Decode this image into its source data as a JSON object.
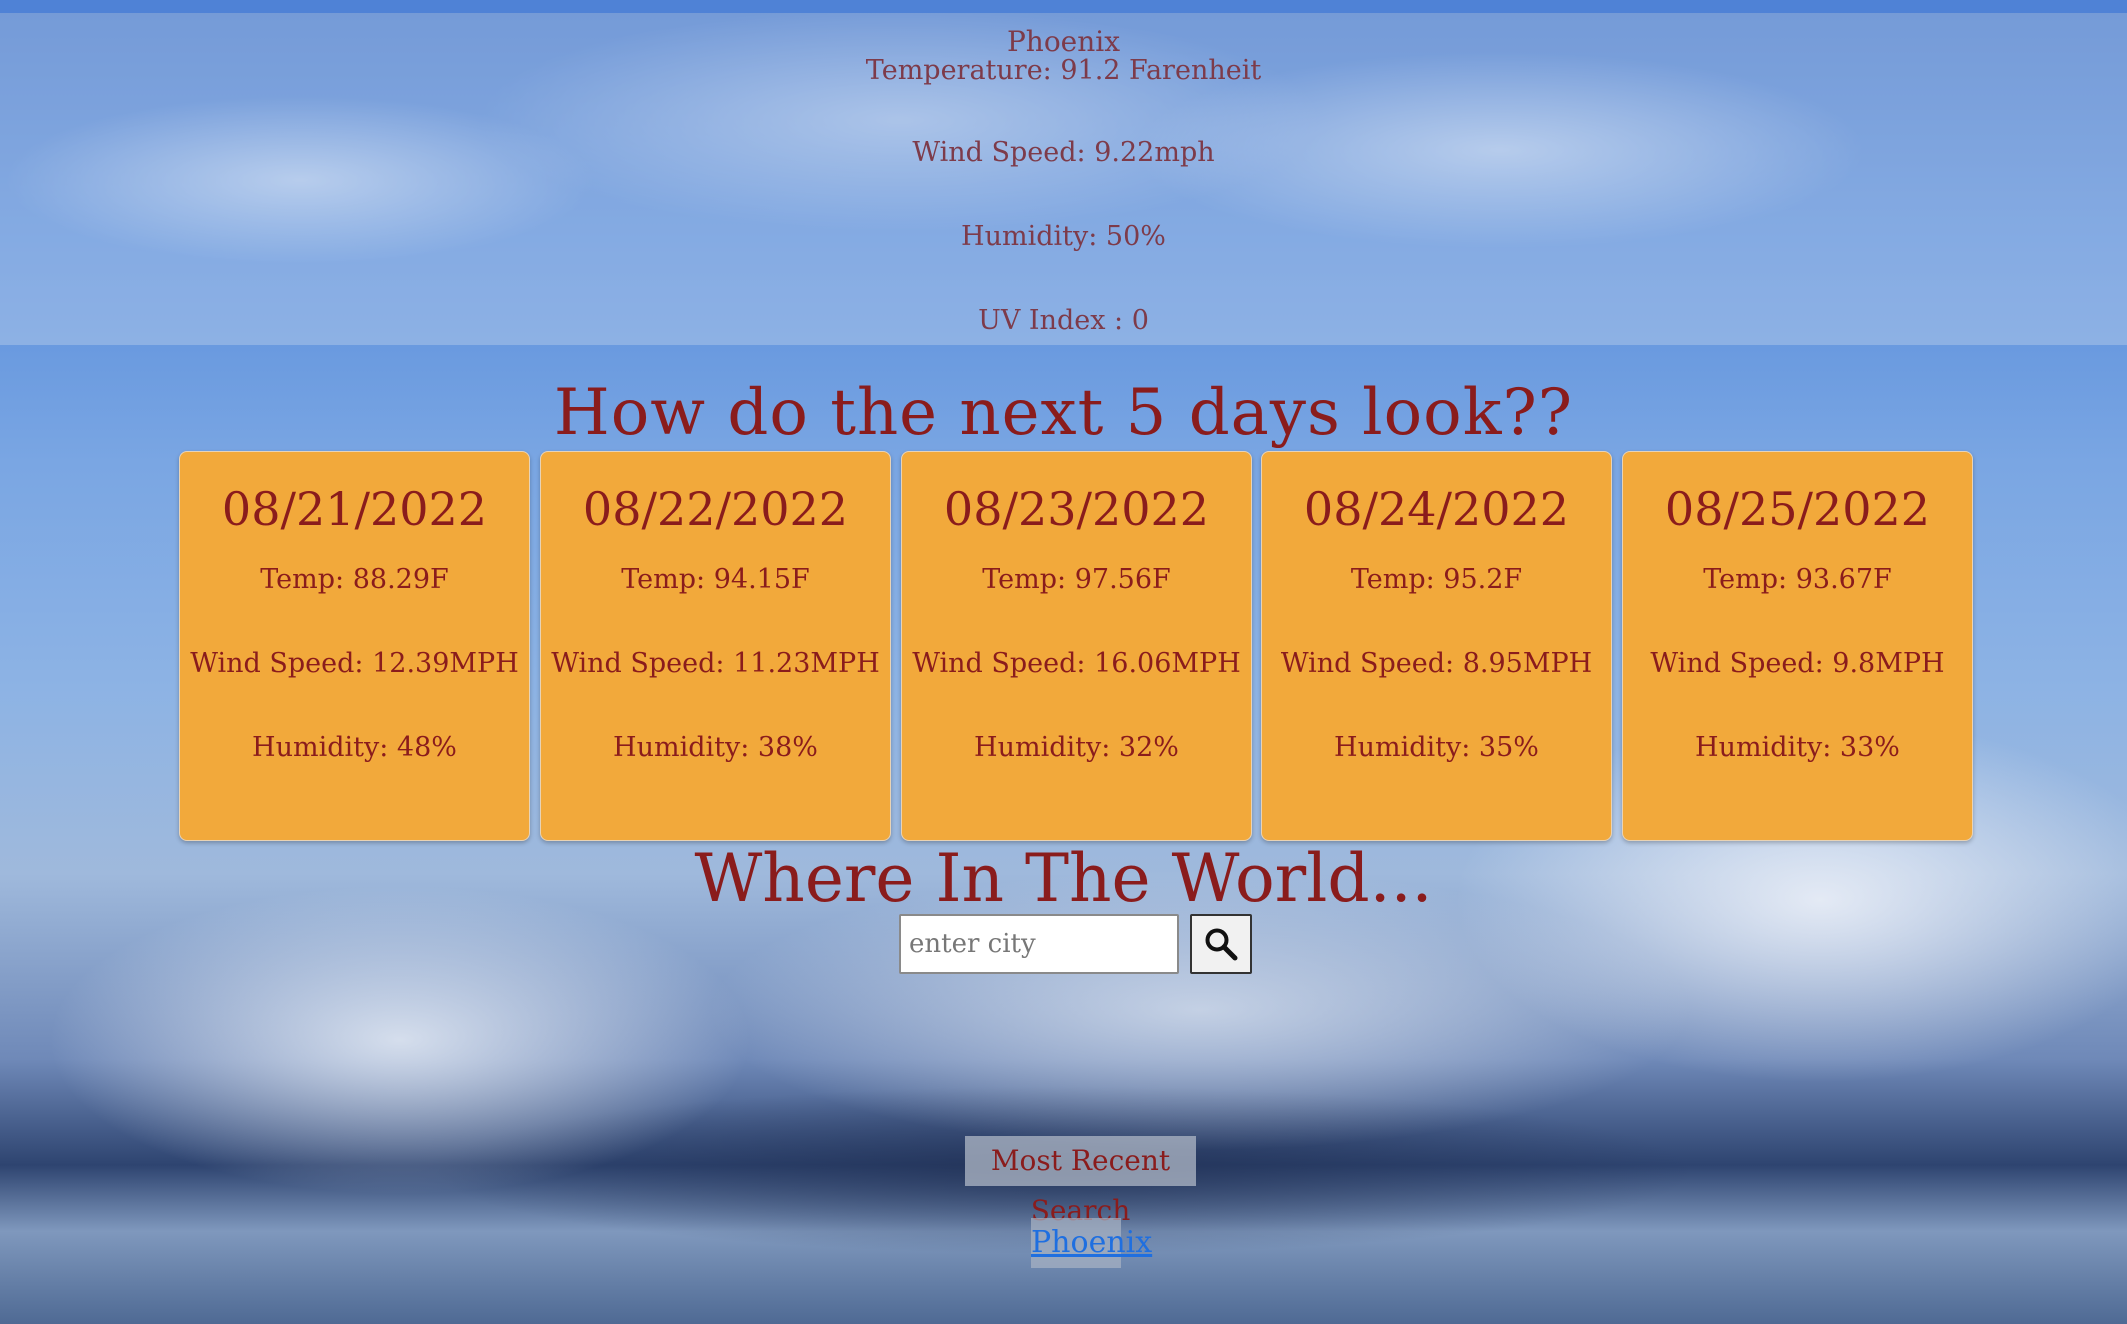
{
  "current": {
    "city": "Phoenix",
    "temperature": "Temperature: 91.2 Farenheit",
    "wind": "Wind Speed: 9.22mph",
    "humidity": "Humidity: 50%",
    "uv": "UV Index : 0"
  },
  "forecast": {
    "title": "How do the next 5 days look??",
    "days": [
      {
        "date": "08/21/2022",
        "temp": "Temp: 88.29F",
        "wind": "Wind Speed: 12.39MPH",
        "humidity": "Humidity: 48%"
      },
      {
        "date": "08/22/2022",
        "temp": "Temp: 94.15F",
        "wind": "Wind Speed: 11.23MPH",
        "humidity": "Humidity: 38%"
      },
      {
        "date": "08/23/2022",
        "temp": "Temp: 97.56F",
        "wind": "Wind Speed: 16.06MPH",
        "humidity": "Humidity: 32%"
      },
      {
        "date": "08/24/2022",
        "temp": "Temp: 95.2F",
        "wind": "Wind Speed: 8.95MPH",
        "humidity": "Humidity: 35%"
      },
      {
        "date": "08/25/2022",
        "temp": "Temp: 93.67F",
        "wind": "Wind Speed: 9.8MPH",
        "humidity": "Humidity: 33%"
      }
    ]
  },
  "search": {
    "title": "Where In The World...",
    "placeholder": "enter city",
    "icon": "search-icon"
  },
  "recent": {
    "label": "Most Recent Search",
    "cities": [
      "Phoenix"
    ]
  },
  "colors": {
    "accent": "#8a1c1c",
    "card": "#f2a93b",
    "link": "#1f6fe0"
  }
}
